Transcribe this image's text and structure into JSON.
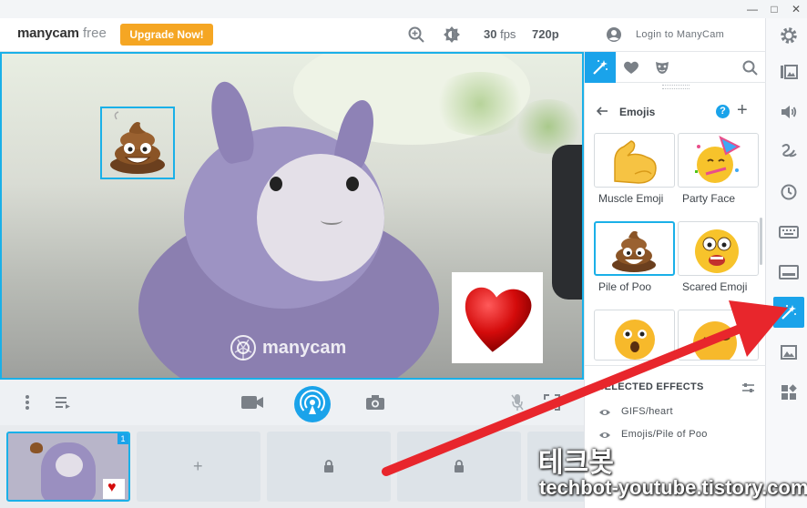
{
  "app": {
    "logo_main": "manycam",
    "logo_suffix": "free",
    "upgrade_label": "Upgrade Now!",
    "fps_value": "30",
    "fps_unit": "fps",
    "resolution": "720p",
    "login_label": "Login to ManyCam"
  },
  "video": {
    "watermark": "manycam"
  },
  "scenes": {
    "active_count": "1",
    "add_label": "+"
  },
  "effects": {
    "section_title": "Emojis",
    "help_label": "?",
    "add_label": "+",
    "tiles": [
      {
        "label": "Muscle Emoji"
      },
      {
        "label": "Party Face"
      },
      {
        "label": "Pile of Poo"
      },
      {
        "label": "Scared Emoji"
      }
    ],
    "selected_title": "SELECTED EFFECTS",
    "selected_items": [
      "GIFS/heart",
      "Emojis/Pile of Poo"
    ]
  },
  "annotation": {
    "blog_name": "테크봇",
    "blog_url": "techbot-youtube.tistory.com"
  },
  "colors": {
    "accent": "#1aa3ea",
    "upgrade": "#f5a623",
    "arrow": "#e8262c"
  },
  "icons": [
    "minimize-icon",
    "maximize-icon",
    "close-icon",
    "zoom-icon",
    "brightness-icon",
    "user-icon",
    "gear-icon",
    "presets-icon",
    "audio-icon",
    "draw-icon",
    "history-icon",
    "keyboard-icon",
    "lower-thirds-icon",
    "effects-icon",
    "image-icon",
    "widgets-icon",
    "more-icon",
    "playlist-icon",
    "video-camera-icon",
    "broadcast-icon",
    "camera-icon",
    "mic-icon",
    "fullscreen-icon",
    "lock-icon",
    "magic-wand-icon",
    "heart-icon",
    "mask-icon",
    "search-icon",
    "back-icon",
    "help-icon",
    "eye-icon",
    "settings-sliders-icon"
  ]
}
